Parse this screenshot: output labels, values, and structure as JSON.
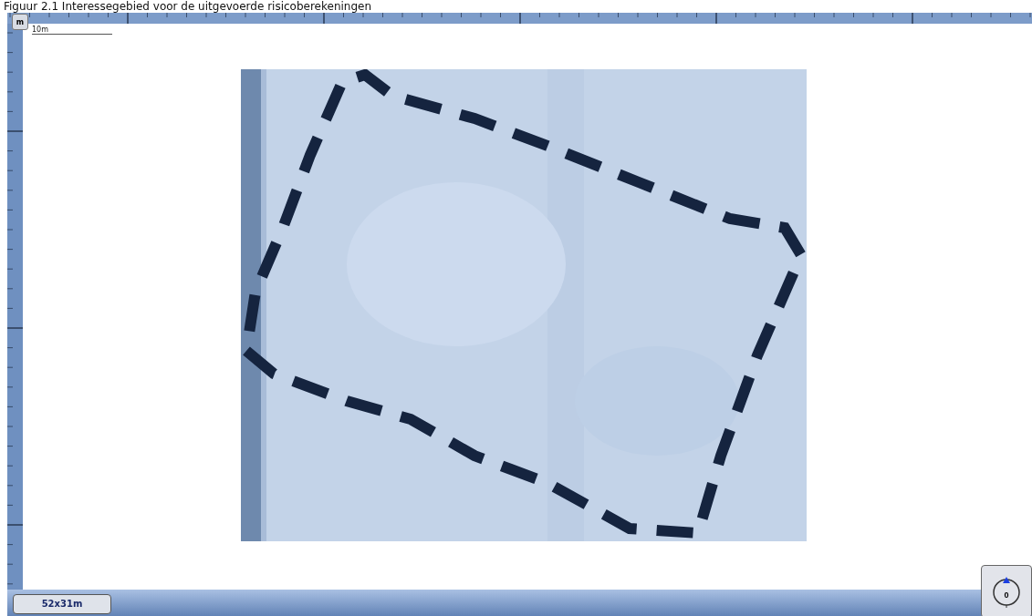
{
  "caption": "Figuur 2.1 Interessegebied voor de uitgevoerde risicoberekeningen",
  "unit_button": "m",
  "scale_label": "10m",
  "status_bar": {
    "dimensions": "52x31m"
  },
  "compass": {
    "reading": "0"
  }
}
